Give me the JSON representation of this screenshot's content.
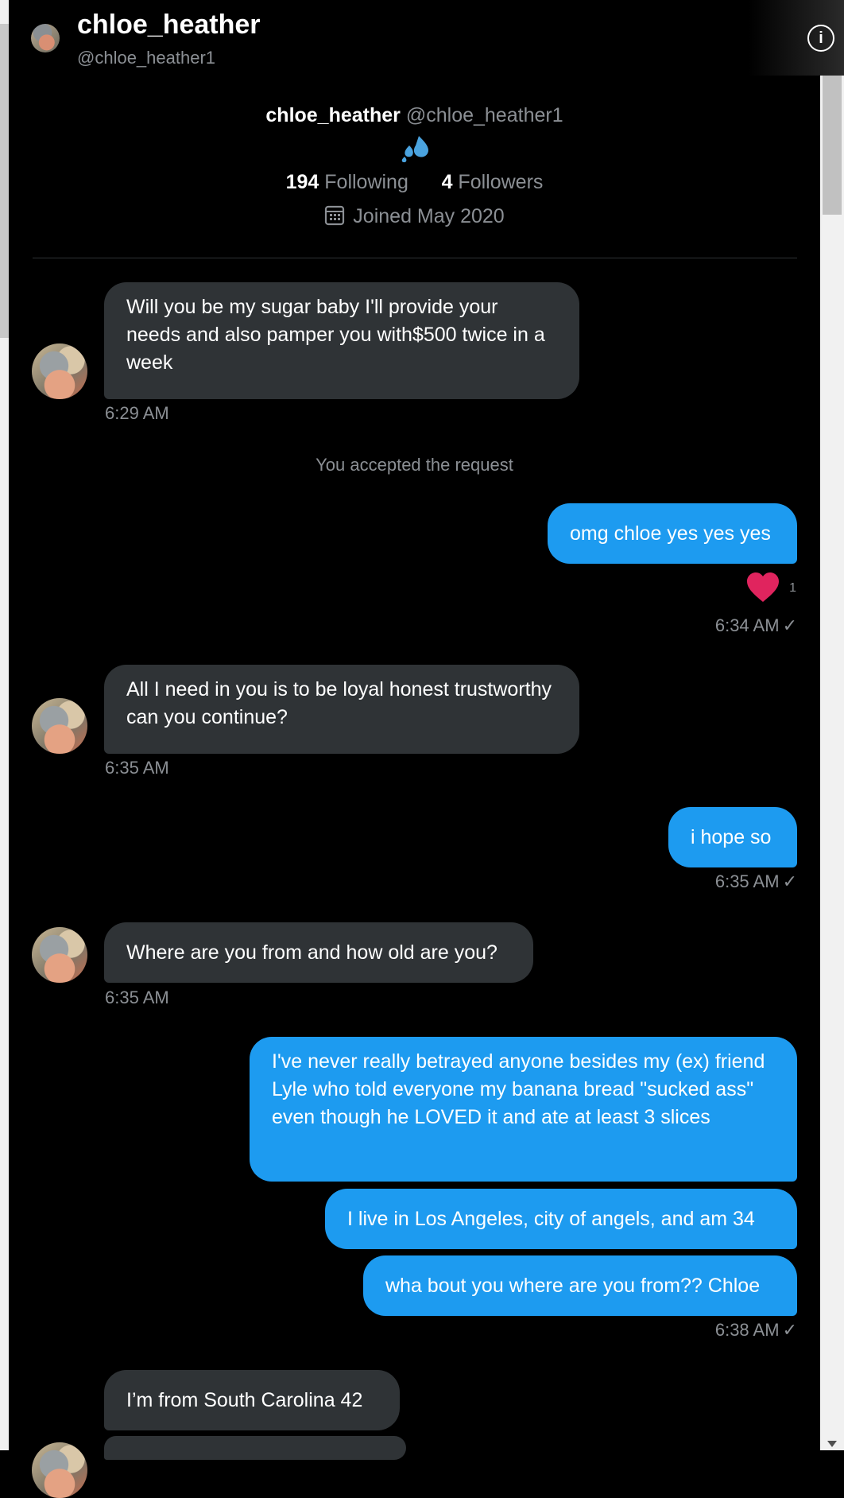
{
  "header": {
    "name": "chloe_heather",
    "handle": "@chloe_heather1"
  },
  "profile": {
    "name": "chloe_heather",
    "handle": "@chloe_heather1",
    "following_count": "194",
    "following_label": "Following",
    "followers_count": "4",
    "followers_label": "Followers",
    "joined": "Joined May 2020",
    "emoji": "sweat-droplets-icon"
  },
  "colors": {
    "outgoing": "#1d9bf0",
    "incoming": "#2f3336",
    "heart": "#f91880"
  },
  "messages": {
    "m1": {
      "text": "Will you be my sugar baby I'll provide your needs and also pamper you with$500 twice in a week",
      "time": "6:29 AM"
    },
    "system": "You accepted the request",
    "m2": {
      "text": "omg chloe yes yes yes",
      "time": "6:34 AM",
      "reactions": "1"
    },
    "m3": {
      "text": "All I need in you is to be loyal honest trustworthy can you continue?",
      "time": "6:35 AM"
    },
    "m4": {
      "text": "i hope so",
      "time": "6:35 AM"
    },
    "m5": {
      "text": "Where are you from and how old are you?",
      "time": "6:35 AM"
    },
    "m6": {
      "text": "I've never really betrayed anyone besides my (ex) friend Lyle who told everyone my banana bread \"sucked ass\" even though he LOVED it and ate at least 3 slices"
    },
    "m7": {
      "text": "I live in Los Angeles, city of angels, and am 34"
    },
    "m8": {
      "text": "wha bout you where are you from?? Chloe",
      "time": "6:38 AM"
    },
    "m9": {
      "text": "I’m from South Carolina 42"
    }
  },
  "check_glyph": "✓"
}
